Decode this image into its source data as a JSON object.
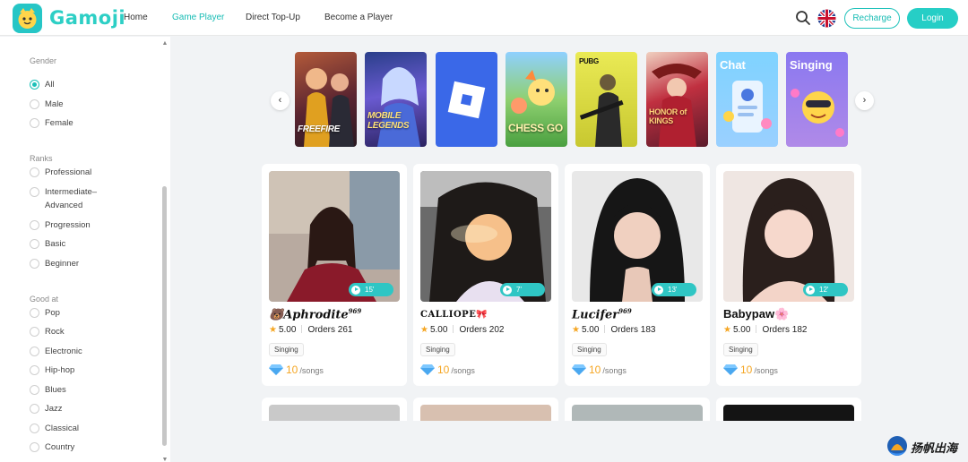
{
  "header": {
    "brand": "Gamoji",
    "nav": [
      "Home",
      "Game Player",
      "Direct Top-Up",
      "Become a Player"
    ],
    "active_nav": "Game Player",
    "recharge_label": "Recharge",
    "login_label": "Login",
    "search_icon": "search-icon",
    "language_icon": "uk-flag-icon"
  },
  "sidebar": {
    "gender": {
      "title": "Gender",
      "options": [
        "All",
        "Male",
        "Female"
      ],
      "selected": "All"
    },
    "ranks": {
      "title": "Ranks",
      "options": [
        "Professional",
        "Intermediate–",
        "Advanced",
        "Progression",
        "Basic",
        "Beginner"
      ]
    },
    "good_at": {
      "title": "Good at",
      "options": [
        "Pop",
        "Rock",
        "Electronic",
        "Hip-hop",
        "Blues",
        "Jazz",
        "Classical",
        "Country"
      ]
    }
  },
  "carousel": {
    "prev_icon": "chevron-left-icon",
    "next_icon": "chevron-right-icon",
    "tiles": [
      {
        "mark": "FREEFIRE",
        "color": "#7a3a3a"
      },
      {
        "mark": "MOBILE LEGENDS",
        "color": "#3a5fb8"
      },
      {
        "mark": "",
        "color": "#3a5fe0"
      },
      {
        "mark": "CHESS GO",
        "color": "#6cbf6a"
      },
      {
        "mark": "PUBG",
        "color": "#d9d94a"
      },
      {
        "mark": "HONOR of KINGS",
        "color": "#8a2a3a"
      },
      {
        "caption": "Chat",
        "color": "#6fc7f0"
      },
      {
        "caption": "Singing",
        "color": "#9a7ae0"
      }
    ]
  },
  "players": [
    {
      "name": "Aphrodite",
      "sup": "969",
      "prefix": "🐻",
      "suffix": "",
      "rating": "5.00",
      "orders_label": "Orders 261",
      "tag": "Singing",
      "price": "10",
      "unit": "/songs",
      "duration": "15'"
    },
    {
      "name": "CALLIOPE",
      "sup": "",
      "prefix": "",
      "suffix": "🎀",
      "rating": "5.00",
      "orders_label": "Orders 202",
      "tag": "Singing",
      "price": "10",
      "unit": "/songs",
      "duration": "7'"
    },
    {
      "name": "Lucifer",
      "sup": "969",
      "prefix": "",
      "suffix": "",
      "rating": "5.00",
      "orders_label": "Orders 183",
      "tag": "Singing",
      "price": "10",
      "unit": "/songs",
      "duration": "13'"
    },
    {
      "name": "Babypaw",
      "sup": "",
      "prefix": "",
      "suffix": "🌸",
      "rating": "5.00",
      "orders_label": "Orders 182",
      "tag": "Singing",
      "price": "10",
      "unit": "/songs",
      "duration": "12'"
    }
  ],
  "watermark": "扬帆出海",
  "colors": {
    "accent": "#26cec6",
    "star": "#f5a623",
    "background": "#f1f3f5"
  }
}
